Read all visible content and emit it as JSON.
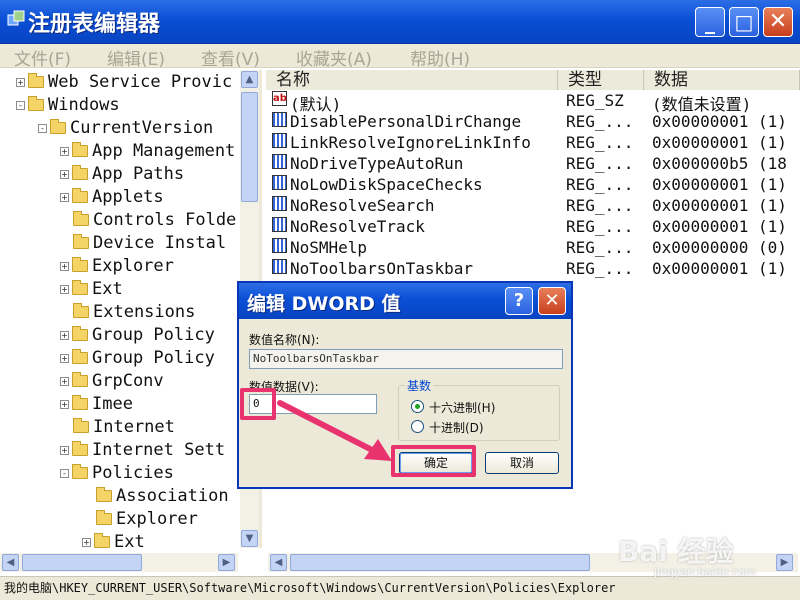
{
  "window": {
    "title": "注册表编辑器",
    "min": "_",
    "max": "□",
    "close": "✕"
  },
  "menu": [
    {
      "label": "文件(F)"
    },
    {
      "label": "编辑(E)"
    },
    {
      "label": "查看(V)"
    },
    {
      "label": "收藏夹(A)"
    },
    {
      "label": "帮助(H)"
    }
  ],
  "tree": [
    {
      "label": "Web Service Provic",
      "expander": "+"
    },
    {
      "label": "Windows",
      "expander": "-"
    },
    {
      "label": "CurrentVersion",
      "expander": "-"
    },
    {
      "label": "App Management",
      "expander": "+"
    },
    {
      "label": "App Paths",
      "expander": "+"
    },
    {
      "label": "Applets",
      "expander": "+"
    },
    {
      "label": "Controls Folde",
      "expander": ""
    },
    {
      "label": "Device Instal",
      "expander": ""
    },
    {
      "label": "Explorer",
      "expander": "+"
    },
    {
      "label": "Ext",
      "expander": "+"
    },
    {
      "label": "Extensions",
      "expander": ""
    },
    {
      "label": "Group Policy",
      "expander": "+"
    },
    {
      "label": "Group Policy",
      "expander": "+"
    },
    {
      "label": "GrpConv",
      "expander": "+"
    },
    {
      "label": "Imee",
      "expander": "+"
    },
    {
      "label": "Internet",
      "expander": ""
    },
    {
      "label": "Internet Sett",
      "expander": "+"
    },
    {
      "label": "Policies",
      "expander": "-"
    },
    {
      "label": "Association",
      "expander": ""
    },
    {
      "label": "Explorer",
      "expander": ""
    },
    {
      "label": "Ext",
      "expander": "+"
    }
  ],
  "columns": {
    "name": "名称",
    "type": "类型",
    "data": "数据"
  },
  "values": [
    {
      "name": "(默认)",
      "type": "REG_SZ",
      "data": "(数值未设置)",
      "icon": "ab"
    },
    {
      "name": "DisablePersonalDirChange",
      "type": "REG_...",
      "data": "0x00000001 (1)",
      "icon": "bin"
    },
    {
      "name": "LinkResolveIgnoreLinkInfo",
      "type": "REG_...",
      "data": "0x00000001 (1)",
      "icon": "bin"
    },
    {
      "name": "NoDriveTypeAutoRun",
      "type": "REG_...",
      "data": "0x000000b5 (18",
      "icon": "bin"
    },
    {
      "name": "NoLowDiskSpaceChecks",
      "type": "REG_...",
      "data": "0x00000001 (1)",
      "icon": "bin"
    },
    {
      "name": "NoResolveSearch",
      "type": "REG_...",
      "data": "0x00000001 (1)",
      "icon": "bin"
    },
    {
      "name": "NoResolveTrack",
      "type": "REG_...",
      "data": "0x00000001 (1)",
      "icon": "bin"
    },
    {
      "name": "NoSMHelp",
      "type": "REG_...",
      "data": "0x00000000 (0)",
      "icon": "bin"
    },
    {
      "name": "NoToolbarsOnTaskbar",
      "type": "REG_...",
      "data": "0x00000001 (1)",
      "icon": "bin"
    }
  ],
  "status": "我的电脑\\HKEY_CURRENT_USER\\Software\\Microsoft\\Windows\\CurrentVersion\\Policies\\Explorer",
  "dialog": {
    "title": "编辑 DWORD 值",
    "help": "?",
    "close": "✕",
    "name_label": "数值名称(N):",
    "name_value": "NoToolbarsOnTaskbar",
    "data_label": "数值数据(V):",
    "data_value": "0",
    "base_label": "基数",
    "hex_label": "十六进制(H)",
    "dec_label": "十进制(D)",
    "ok": "确定",
    "cancel": "取消"
  },
  "watermark": {
    "logo": "Bai 经验",
    "url": "jingyan.baidu.com"
  },
  "colors": {
    "titlebar": "#0a4fd6",
    "highlight": "#e8336e",
    "dialog_bg": "#ece9d8"
  }
}
